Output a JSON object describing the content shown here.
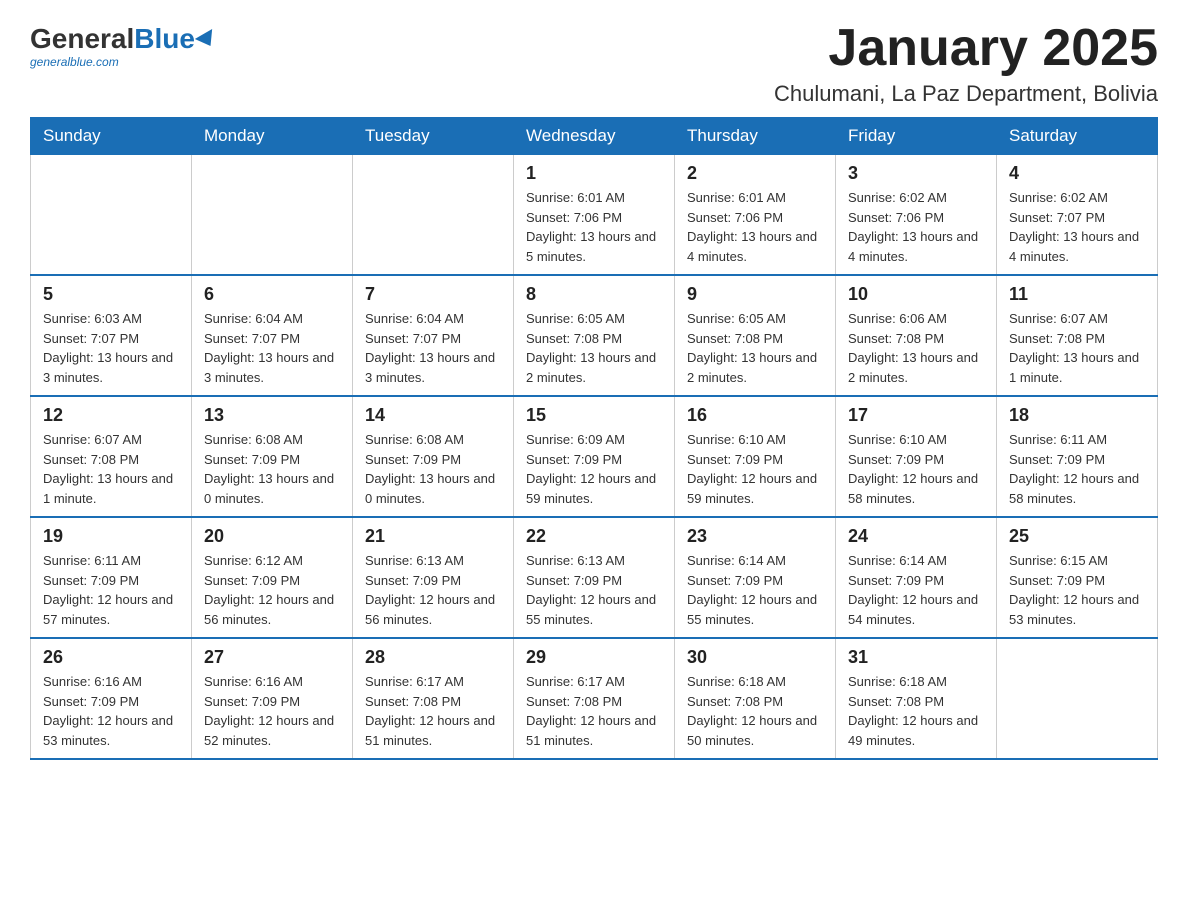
{
  "logo": {
    "general": "General",
    "blue": "Blue",
    "tagline": "generalblue.com"
  },
  "title": "January 2025",
  "subtitle": "Chulumani, La Paz Department, Bolivia",
  "days_of_week": [
    "Sunday",
    "Monday",
    "Tuesday",
    "Wednesday",
    "Thursday",
    "Friday",
    "Saturday"
  ],
  "weeks": [
    [
      {
        "day": "",
        "info": ""
      },
      {
        "day": "",
        "info": ""
      },
      {
        "day": "",
        "info": ""
      },
      {
        "day": "1",
        "info": "Sunrise: 6:01 AM\nSunset: 7:06 PM\nDaylight: 13 hours and 5 minutes."
      },
      {
        "day": "2",
        "info": "Sunrise: 6:01 AM\nSunset: 7:06 PM\nDaylight: 13 hours and 4 minutes."
      },
      {
        "day": "3",
        "info": "Sunrise: 6:02 AM\nSunset: 7:06 PM\nDaylight: 13 hours and 4 minutes."
      },
      {
        "day": "4",
        "info": "Sunrise: 6:02 AM\nSunset: 7:07 PM\nDaylight: 13 hours and 4 minutes."
      }
    ],
    [
      {
        "day": "5",
        "info": "Sunrise: 6:03 AM\nSunset: 7:07 PM\nDaylight: 13 hours and 3 minutes."
      },
      {
        "day": "6",
        "info": "Sunrise: 6:04 AM\nSunset: 7:07 PM\nDaylight: 13 hours and 3 minutes."
      },
      {
        "day": "7",
        "info": "Sunrise: 6:04 AM\nSunset: 7:07 PM\nDaylight: 13 hours and 3 minutes."
      },
      {
        "day": "8",
        "info": "Sunrise: 6:05 AM\nSunset: 7:08 PM\nDaylight: 13 hours and 2 minutes."
      },
      {
        "day": "9",
        "info": "Sunrise: 6:05 AM\nSunset: 7:08 PM\nDaylight: 13 hours and 2 minutes."
      },
      {
        "day": "10",
        "info": "Sunrise: 6:06 AM\nSunset: 7:08 PM\nDaylight: 13 hours and 2 minutes."
      },
      {
        "day": "11",
        "info": "Sunrise: 6:07 AM\nSunset: 7:08 PM\nDaylight: 13 hours and 1 minute."
      }
    ],
    [
      {
        "day": "12",
        "info": "Sunrise: 6:07 AM\nSunset: 7:08 PM\nDaylight: 13 hours and 1 minute."
      },
      {
        "day": "13",
        "info": "Sunrise: 6:08 AM\nSunset: 7:09 PM\nDaylight: 13 hours and 0 minutes."
      },
      {
        "day": "14",
        "info": "Sunrise: 6:08 AM\nSunset: 7:09 PM\nDaylight: 13 hours and 0 minutes."
      },
      {
        "day": "15",
        "info": "Sunrise: 6:09 AM\nSunset: 7:09 PM\nDaylight: 12 hours and 59 minutes."
      },
      {
        "day": "16",
        "info": "Sunrise: 6:10 AM\nSunset: 7:09 PM\nDaylight: 12 hours and 59 minutes."
      },
      {
        "day": "17",
        "info": "Sunrise: 6:10 AM\nSunset: 7:09 PM\nDaylight: 12 hours and 58 minutes."
      },
      {
        "day": "18",
        "info": "Sunrise: 6:11 AM\nSunset: 7:09 PM\nDaylight: 12 hours and 58 minutes."
      }
    ],
    [
      {
        "day": "19",
        "info": "Sunrise: 6:11 AM\nSunset: 7:09 PM\nDaylight: 12 hours and 57 minutes."
      },
      {
        "day": "20",
        "info": "Sunrise: 6:12 AM\nSunset: 7:09 PM\nDaylight: 12 hours and 56 minutes."
      },
      {
        "day": "21",
        "info": "Sunrise: 6:13 AM\nSunset: 7:09 PM\nDaylight: 12 hours and 56 minutes."
      },
      {
        "day": "22",
        "info": "Sunrise: 6:13 AM\nSunset: 7:09 PM\nDaylight: 12 hours and 55 minutes."
      },
      {
        "day": "23",
        "info": "Sunrise: 6:14 AM\nSunset: 7:09 PM\nDaylight: 12 hours and 55 minutes."
      },
      {
        "day": "24",
        "info": "Sunrise: 6:14 AM\nSunset: 7:09 PM\nDaylight: 12 hours and 54 minutes."
      },
      {
        "day": "25",
        "info": "Sunrise: 6:15 AM\nSunset: 7:09 PM\nDaylight: 12 hours and 53 minutes."
      }
    ],
    [
      {
        "day": "26",
        "info": "Sunrise: 6:16 AM\nSunset: 7:09 PM\nDaylight: 12 hours and 53 minutes."
      },
      {
        "day": "27",
        "info": "Sunrise: 6:16 AM\nSunset: 7:09 PM\nDaylight: 12 hours and 52 minutes."
      },
      {
        "day": "28",
        "info": "Sunrise: 6:17 AM\nSunset: 7:08 PM\nDaylight: 12 hours and 51 minutes."
      },
      {
        "day": "29",
        "info": "Sunrise: 6:17 AM\nSunset: 7:08 PM\nDaylight: 12 hours and 51 minutes."
      },
      {
        "day": "30",
        "info": "Sunrise: 6:18 AM\nSunset: 7:08 PM\nDaylight: 12 hours and 50 minutes."
      },
      {
        "day": "31",
        "info": "Sunrise: 6:18 AM\nSunset: 7:08 PM\nDaylight: 12 hours and 49 minutes."
      },
      {
        "day": "",
        "info": ""
      }
    ]
  ],
  "colors": {
    "header_bg": "#1a6eb5",
    "header_text": "#ffffff",
    "border": "#1a6eb5"
  }
}
